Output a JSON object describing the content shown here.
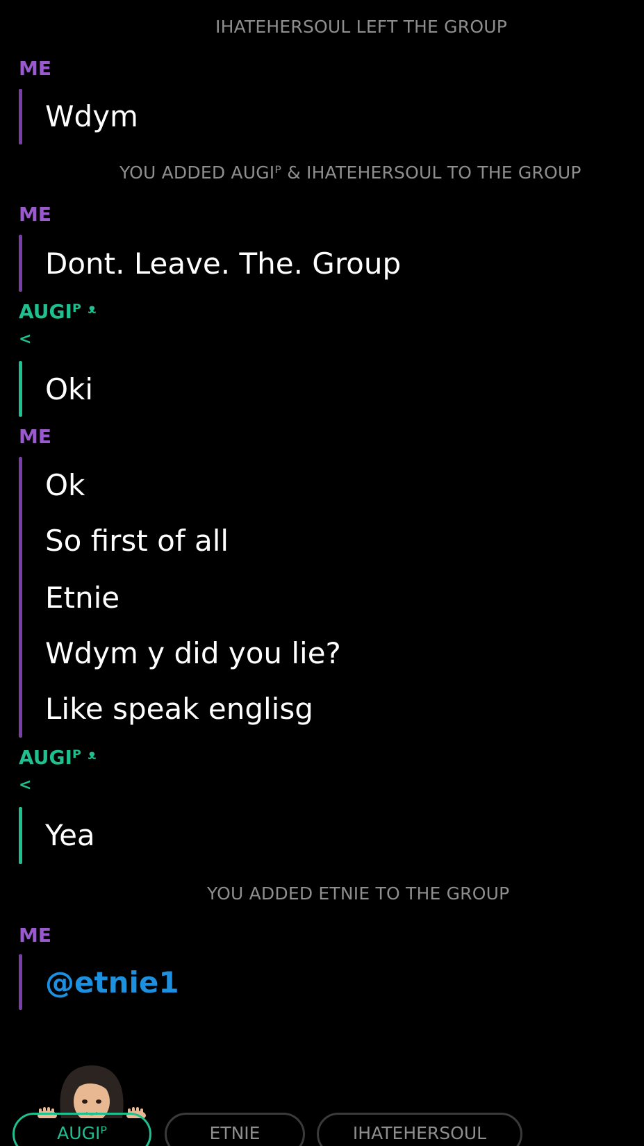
{
  "system": {
    "left_group": "IHATEHERSOUL LEFT THE GROUP",
    "added_two": "YOU ADDED AUGIᴾ & IHATEHERSOUL TO THE GROUP",
    "added_etnie": "YOU ADDED ETNIE TO THE GROUP"
  },
  "senders": {
    "me": "ME",
    "augi": "AUGIᴾ ᵜ",
    "augi_sub": "<"
  },
  "messages": {
    "m1": "Wdym",
    "m2": "Dont. Leave. The. Group",
    "m3": "Oki",
    "m4": "Ok",
    "m5": "So first of all",
    "m6": "Etnie",
    "m7": "Wdym y did you lie?",
    "m8": "Like speak englisg",
    "m9": "Yea",
    "m10": "@etnie1"
  },
  "participants": [
    {
      "label": "AUGIᴾ",
      "active": true
    },
    {
      "label": "ETNIE",
      "active": false
    },
    {
      "label": "IHATEHERSOUL",
      "active": false
    }
  ],
  "colors": {
    "me": "#9b59d0",
    "augi": "#1fbf8f",
    "mention": "#1e90e0",
    "system": "#8e8e8e"
  },
  "icons": {
    "avatar": "bitmoji-avatar-icon"
  }
}
